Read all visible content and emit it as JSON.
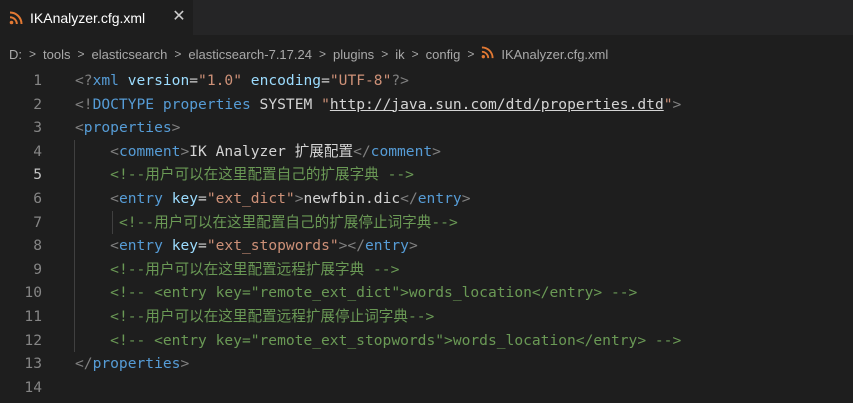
{
  "tab": {
    "title": "IKAnalyzer.cfg.xml",
    "close_glyph": "✕"
  },
  "breadcrumb": {
    "items": [
      "D:",
      "tools",
      "elasticsearch",
      "elasticsearch-7.17.24",
      "plugins",
      "ik",
      "config"
    ],
    "file": "IKAnalyzer.cfg.xml",
    "separator": ">"
  },
  "editor": {
    "active_line": 5,
    "lines": [
      {
        "n": "1",
        "tokens": [
          [
            "p",
            "<?"
          ],
          [
            "tag",
            "xml"
          ],
          [
            "txt",
            " "
          ],
          [
            "attr",
            "version"
          ],
          [
            "txt",
            "="
          ],
          [
            "str",
            "\"1.0\""
          ],
          [
            "txt",
            " "
          ],
          [
            "attr",
            "encoding"
          ],
          [
            "txt",
            "="
          ],
          [
            "str",
            "\"UTF-8\""
          ],
          [
            "p",
            "?>"
          ]
        ]
      },
      {
        "n": "2",
        "tokens": [
          [
            "p",
            "<!"
          ],
          [
            "tag",
            "DOCTYPE"
          ],
          [
            "txt",
            " "
          ],
          [
            "tag",
            "properties"
          ],
          [
            "txt",
            " SYSTEM "
          ],
          [
            "str",
            "\""
          ],
          [
            "url",
            "http://java.sun.com/dtd/properties.dtd"
          ],
          [
            "str",
            "\""
          ],
          [
            "p",
            ">"
          ]
        ]
      },
      {
        "n": "3",
        "tokens": [
          [
            "p",
            "<"
          ],
          [
            "tag",
            "properties"
          ],
          [
            "p",
            ">"
          ]
        ]
      },
      {
        "n": "4",
        "tokens": [
          [
            "txt",
            "    "
          ],
          [
            "p",
            "<"
          ],
          [
            "tag",
            "comment"
          ],
          [
            "p",
            ">"
          ],
          [
            "txt",
            "IK Analyzer 扩展配置"
          ],
          [
            "p",
            "</"
          ],
          [
            "tag",
            "comment"
          ],
          [
            "p",
            ">"
          ]
        ]
      },
      {
        "n": "5",
        "tokens": [
          [
            "txt",
            "    "
          ],
          [
            "cmt",
            "<!--用户可以在这里配置自己的扩展字典 -->"
          ]
        ]
      },
      {
        "n": "6",
        "tokens": [
          [
            "txt",
            "    "
          ],
          [
            "p",
            "<"
          ],
          [
            "tag",
            "entry"
          ],
          [
            "txt",
            " "
          ],
          [
            "attr",
            "key"
          ],
          [
            "txt",
            "="
          ],
          [
            "str",
            "\"ext_dict\""
          ],
          [
            "p",
            ">"
          ],
          [
            "txt",
            "newfbin.dic"
          ],
          [
            "p",
            "</"
          ],
          [
            "tag",
            "entry"
          ],
          [
            "p",
            ">"
          ]
        ]
      },
      {
        "n": "7",
        "tokens": [
          [
            "txt",
            "     "
          ],
          [
            "cmt",
            "<!--用户可以在这里配置自己的扩展停止词字典-->"
          ]
        ]
      },
      {
        "n": "8",
        "tokens": [
          [
            "txt",
            "    "
          ],
          [
            "p",
            "<"
          ],
          [
            "tag",
            "entry"
          ],
          [
            "txt",
            " "
          ],
          [
            "attr",
            "key"
          ],
          [
            "txt",
            "="
          ],
          [
            "str",
            "\"ext_stopwords\""
          ],
          [
            "p",
            "></"
          ],
          [
            "tag",
            "entry"
          ],
          [
            "p",
            ">"
          ]
        ]
      },
      {
        "n": "9",
        "tokens": [
          [
            "txt",
            "    "
          ],
          [
            "cmt",
            "<!--用户可以在这里配置远程扩展字典 -->"
          ]
        ]
      },
      {
        "n": "10",
        "tokens": [
          [
            "txt",
            "    "
          ],
          [
            "cmt",
            "<!-- <entry key=\"remote_ext_dict\">words_location</entry> -->"
          ]
        ]
      },
      {
        "n": "11",
        "tokens": [
          [
            "txt",
            "    "
          ],
          [
            "cmt",
            "<!--用户可以在这里配置远程扩展停止词字典-->"
          ]
        ]
      },
      {
        "n": "12",
        "tokens": [
          [
            "txt",
            "    "
          ],
          [
            "cmt",
            "<!-- <entry key=\"remote_ext_stopwords\">words_location</entry> -->"
          ]
        ]
      },
      {
        "n": "13",
        "tokens": [
          [
            "p",
            "</"
          ],
          [
            "tag",
            "properties"
          ],
          [
            "p",
            ">"
          ]
        ]
      },
      {
        "n": "14",
        "tokens": []
      }
    ]
  },
  "colors": {
    "background": "#1e1e1e",
    "tag": "#569cd6",
    "attribute": "#9cdcfe",
    "string": "#ce9178",
    "comment": "#6a9955",
    "rss_icon": "#e37933"
  }
}
